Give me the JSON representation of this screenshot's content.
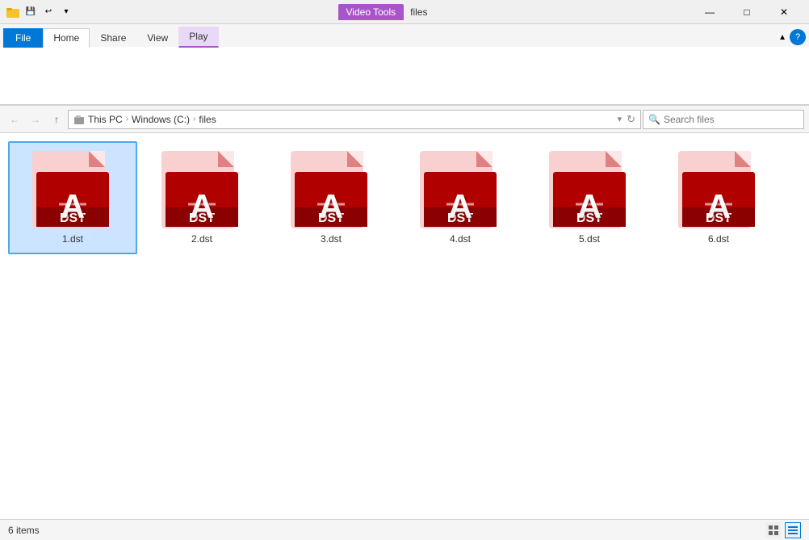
{
  "titleBar": {
    "title": "files",
    "videoTools": "Video Tools",
    "minimizeLabel": "—",
    "maximizeLabel": "□",
    "closeLabel": "✕"
  },
  "ribbon": {
    "tabs": [
      {
        "id": "file",
        "label": "File",
        "type": "file"
      },
      {
        "id": "home",
        "label": "Home",
        "type": "normal"
      },
      {
        "id": "share",
        "label": "Share",
        "type": "normal"
      },
      {
        "id": "view",
        "label": "View",
        "type": "normal"
      },
      {
        "id": "play",
        "label": "Play",
        "type": "highlighted"
      }
    ]
  },
  "addressBar": {
    "breadcrumbs": [
      "This PC",
      "Windows (C:)",
      "files"
    ],
    "searchPlaceholder": "Search files",
    "searchLabel": "Search"
  },
  "files": [
    {
      "id": 1,
      "name": "1.dst",
      "selected": true
    },
    {
      "id": 2,
      "name": "2.dst",
      "selected": false
    },
    {
      "id": 3,
      "name": "3.dst",
      "selected": false
    },
    {
      "id": 4,
      "name": "4.dst",
      "selected": false
    },
    {
      "id": 5,
      "name": "5.dst",
      "selected": false
    },
    {
      "id": 6,
      "name": "6.dst",
      "selected": false
    }
  ],
  "statusBar": {
    "itemCount": "6 items"
  }
}
